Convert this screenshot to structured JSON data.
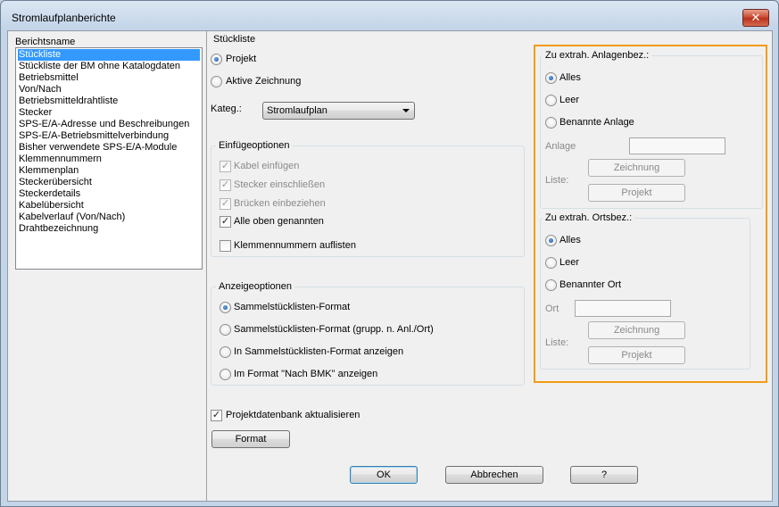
{
  "window": {
    "title": "Stromlaufplanberichte",
    "close_glyph": "✕"
  },
  "report_list": {
    "header": "Berichtsname",
    "items": [
      "Stückliste",
      "Stückliste der BM ohne Katalogdaten",
      "Betriebsmittel",
      "Von/Nach",
      "Betriebsmitteldrahtliste",
      "Stecker",
      "SPS-E/A-Adresse und Beschreibungen",
      "SPS-E/A-Betriebsmittelverbindung",
      "Bisher verwendete SPS-E/A-Module",
      "Klemmennummern",
      "Klemmenplan",
      "Steckerübersicht",
      "Steckerdetails",
      "Kabelübersicht",
      "Kabelverlauf (Von/Nach)",
      "Drahtbezeichnung"
    ],
    "selected": "Stückliste"
  },
  "stueckliste": {
    "title": "Stückliste",
    "radio_projekt": "Projekt",
    "radio_aktive": "Aktive Zeichnung",
    "kategorie_label": "Kateg.:",
    "kategorie_value": "Stromlaufplan"
  },
  "einfuegeoptionen": {
    "title": "Einfügeoptionen",
    "kabel": "Kabel einfügen",
    "stecker": "Stecker einschließen",
    "bruecken": "Brücken einbeziehen",
    "alle": "Alle oben genannten",
    "klemmen": "Klemmennummern auflisten",
    "check_glyph": "✓"
  },
  "anzeigeoptionen": {
    "title": "Anzeigeoptionen",
    "opt1": "Sammelstücklisten-Format",
    "opt2": "Sammelstücklisten-Format (grupp. n. Anl./Ort)",
    "opt3": "In Sammelstücklisten-Format anzeigen",
    "opt4": "Im Format \"Nach BMK\" anzeigen"
  },
  "db_update": "Projektdatenbank aktualisieren",
  "format_button": "Format",
  "anlagen": {
    "title": "Zu extrah. Anlagenbez.:",
    "alles": "Alles",
    "leer": "Leer",
    "benannt": "Benannte Anlage",
    "field_label": "Anlage",
    "list_label": "Liste:",
    "zeichnung": "Zeichnung",
    "projekt": "Projekt"
  },
  "orte": {
    "title": "Zu extrah. Ortsbez.:",
    "alles": "Alles",
    "leer": "Leer",
    "benannt": "Benannter Ort",
    "field_label": "Ort",
    "list_label": "Liste:",
    "zeichnung": "Zeichnung",
    "projekt": "Projekt"
  },
  "buttons": {
    "ok": "OK",
    "cancel": "Abbrechen",
    "help": "?"
  },
  "highlight_color": "#f39c12"
}
